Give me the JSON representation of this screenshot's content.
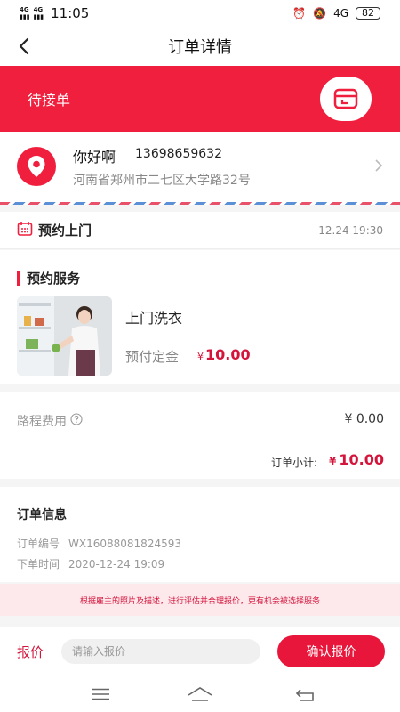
{
  "status_bar": {
    "network_1": "4G",
    "network_2": "4G",
    "time": "11:05",
    "signal_label": "4G",
    "battery": "82"
  },
  "nav": {
    "title": "订单详情"
  },
  "order_status": {
    "label": "待接单"
  },
  "address": {
    "name": "你好啊",
    "phone": "13698659632",
    "line": "河南省郑州市二七区大学路32号"
  },
  "appointment": {
    "label": "预约上门",
    "time": "12.24 19:30"
  },
  "service": {
    "heading": "预约服务",
    "name": "上门洗衣",
    "deposit_label": "预付定金",
    "currency": "¥",
    "deposit_amount": "10.00"
  },
  "costs": {
    "trip_label": "路程费用",
    "trip_fee": "¥ 0.00",
    "subtotal_label": "订单小计:",
    "subtotal_currency": "¥",
    "subtotal_amount": "10.00"
  },
  "order_info": {
    "title": "订单信息",
    "number_label": "订单编号",
    "number": "WX16088081824593",
    "time_label": "下单时间",
    "time": "2020-12-24 19:09"
  },
  "notice": {
    "text": "根据雇主的照片及描述，进行评估并合理报价，更有机会被选择服务"
  },
  "quote": {
    "label": "报价",
    "placeholder": "请输入报价",
    "confirm_label": "确认报价"
  },
  "colors": {
    "brand": "#ef1f3d",
    "price": "#d4143a",
    "notice_bg": "#fde8ec"
  },
  "icons": {
    "back": "back-arrow-icon",
    "banner": "order-box-icon",
    "location": "location-pin-icon",
    "chevron": "chevron-right-icon",
    "calendar": "calendar-icon",
    "help": "question-circle-icon",
    "menu": "menu-icon",
    "home": "home-icon",
    "return": "return-icon"
  }
}
